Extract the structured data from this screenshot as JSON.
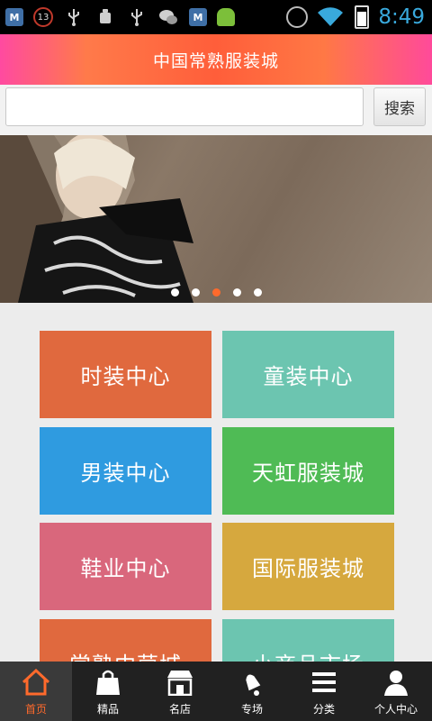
{
  "statusbar": {
    "badge_count": "13",
    "clock": "8:49",
    "icons": [
      "m-app-icon",
      "notification-count-icon",
      "usb-icon",
      "android-debug-icon",
      "usb-icon",
      "wechat-icon",
      "m-app-icon",
      "android-icon",
      "alarm-icon",
      "wifi-icon",
      "battery-icon"
    ]
  },
  "header": {
    "title": "中国常熟服装城"
  },
  "search": {
    "placeholder": "",
    "value": "",
    "button_label": "搜索"
  },
  "banner": {
    "slide_count": 5,
    "active_slide": 3
  },
  "categories": [
    {
      "label": "时装中心",
      "color": "#e0693e"
    },
    {
      "label": "童装中心",
      "color": "#6cc5b0"
    },
    {
      "label": "男装中心",
      "color": "#2f9be0"
    },
    {
      "label": "天虹服装城",
      "color": "#4fbb55"
    },
    {
      "label": "鞋业中心",
      "color": "#d9677c"
    },
    {
      "label": "国际服装城",
      "color": "#d6a83e"
    },
    {
      "label": "常熟中茵城",
      "color": "#e0693e"
    },
    {
      "label": "小商品市场",
      "color": "#6cc5b0"
    }
  ],
  "tabs": [
    {
      "label": "首页",
      "icon": "home-icon"
    },
    {
      "label": "精品",
      "icon": "shopping-bag-icon"
    },
    {
      "label": "名店",
      "icon": "storefront-icon"
    },
    {
      "label": "专场",
      "icon": "bell-icon"
    },
    {
      "label": "分类",
      "icon": "list-icon"
    },
    {
      "label": "个人中心",
      "icon": "user-icon"
    }
  ],
  "active_tab": 0,
  "colors": {
    "header_accent": "#ff5e3a",
    "active": "#ff6a2c",
    "tabbar": "#212121",
    "clock": "#39a9dc"
  }
}
